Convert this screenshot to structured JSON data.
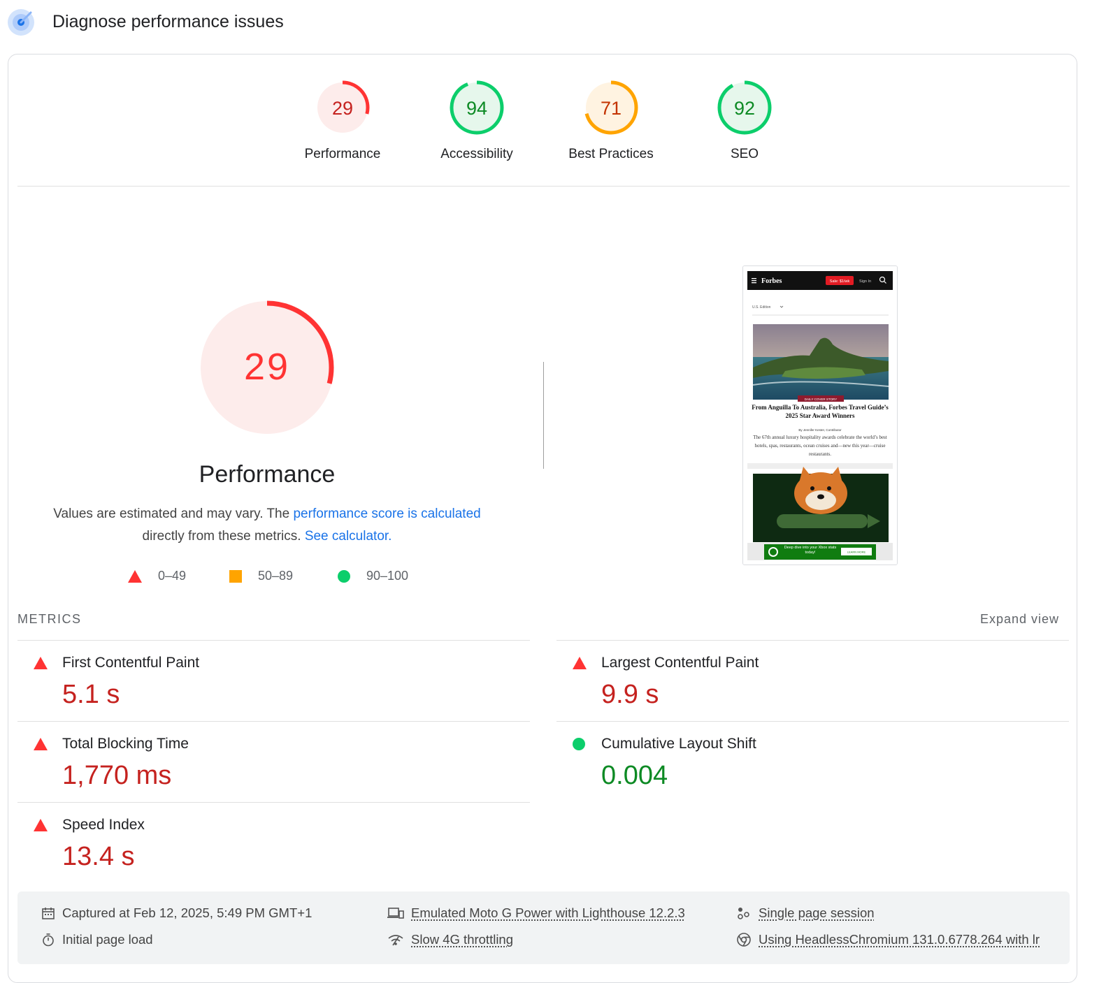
{
  "header": {
    "title": "Diagnose performance issues",
    "icon": "lighthouse-icon"
  },
  "gauges": [
    {
      "score": "29",
      "label": "Performance",
      "value": 29,
      "color": "#ff3333",
      "text_color": "#c5221f",
      "bg": "#fdeceb"
    },
    {
      "score": "94",
      "label": "Accessibility",
      "value": 94,
      "color": "#0cce6b",
      "text_color": "#0d8a24",
      "bg": "#e6f7ec"
    },
    {
      "score": "71",
      "label": "Best Practices",
      "value": 71,
      "color": "#ffa400",
      "text_color": "#c33300",
      "bg": "#fff3e1"
    },
    {
      "score": "92",
      "label": "SEO",
      "value": 92,
      "color": "#0cce6b",
      "text_color": "#0d8a24",
      "bg": "#e6f7ec"
    }
  ],
  "performance": {
    "score": "29",
    "value": 29,
    "title": "Performance",
    "desc_part1": "Values are estimated and may vary. The ",
    "desc_link1": "performance score is calculated",
    "desc_part2": " directly from these metrics. ",
    "desc_link2": "See calculator."
  },
  "legend": [
    {
      "shape": "triangle",
      "range": "0–49",
      "color": "#ff3333"
    },
    {
      "shape": "square",
      "range": "50–89",
      "color": "#ffa400"
    },
    {
      "shape": "circle",
      "range": "90–100",
      "color": "#0cce6b"
    }
  ],
  "thumbnail": {
    "brand": "Forbes",
    "subscribe": "Sale: $1/wk",
    "signin": "Sign In",
    "edition": "U.S. Edition",
    "tag": "DAILY COVER STORY",
    "headline": "From Anguilla To Australia, Forbes Travel Guide’s 2025 Star Award Winners",
    "byline": "By Jennifer Kester, Contributor",
    "summary": "The 67th annual luxury hospitality awards celebrate the world’s best hotels, spas, restaurants, ocean cruises and—new this year—cruise restaurants.",
    "ad_text": "Deep dive into your Xbox stats today!",
    "ad_button": "LEARN MORE"
  },
  "metrics": {
    "heading": "METRICS",
    "expand": "Expand view",
    "items": [
      {
        "name": "First Contentful Paint",
        "value": "5.1 s",
        "status": "fail"
      },
      {
        "name": "Largest Contentful Paint",
        "value": "9.9 s",
        "status": "fail"
      },
      {
        "name": "Total Blocking Time",
        "value": "1,770 ms",
        "status": "fail"
      },
      {
        "name": "Cumulative Layout Shift",
        "value": "0.004",
        "status": "pass"
      },
      {
        "name": "Speed Index",
        "value": "13.4 s",
        "status": "fail"
      }
    ]
  },
  "footer": {
    "captured": "Captured at Feb 12, 2025, 5:49 PM GMT+1",
    "load": "Initial page load",
    "device": "Emulated Moto G Power with Lighthouse 12.2.3",
    "throttle": "Slow 4G throttling",
    "session": "Single page session",
    "browser": "Using HeadlessChromium 131.0.6778.264 with lr"
  }
}
